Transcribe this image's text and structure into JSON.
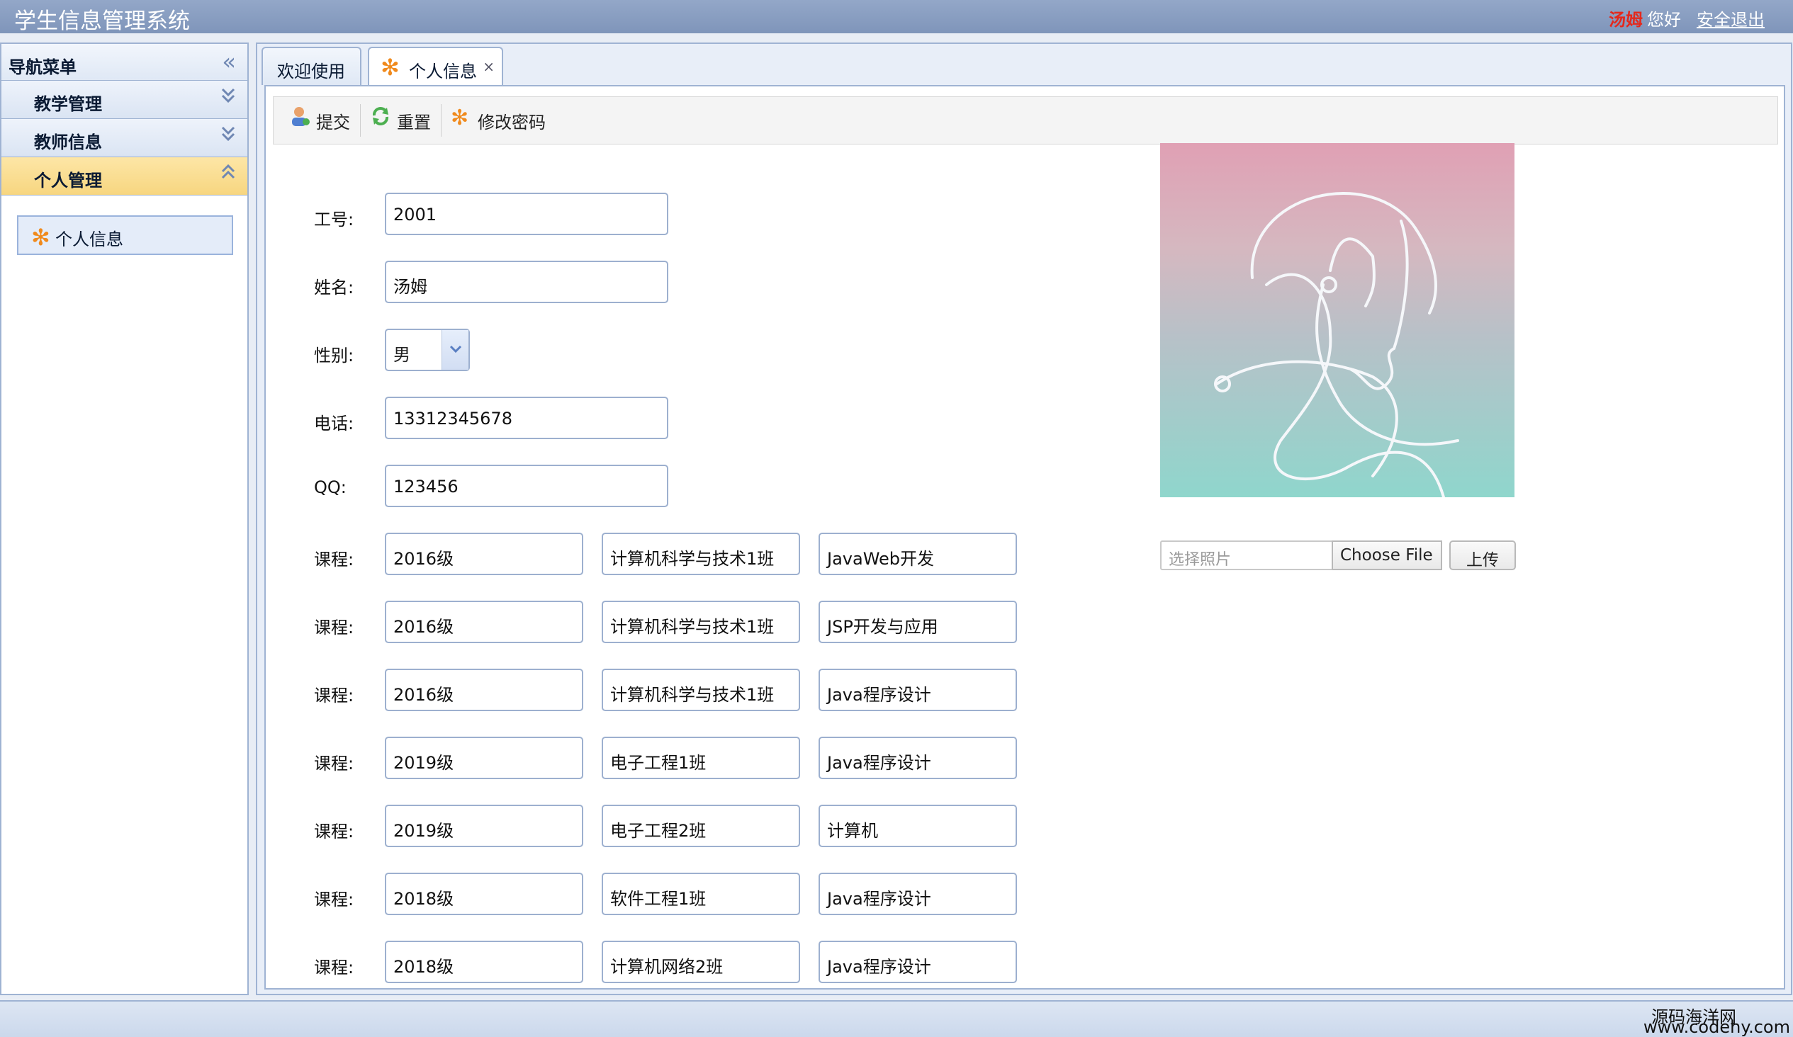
{
  "header": {
    "title": "学生信息管理系统",
    "user_name": "汤姆",
    "greeting": "您好",
    "logout": "安全退出"
  },
  "sidebar": {
    "title": "导航菜单",
    "collapse_icon": "double-chevron-left-icon",
    "groups": [
      {
        "label": "教学管理",
        "icon": "double-chevron-down-icon"
      },
      {
        "label": "教师信息",
        "icon": "double-chevron-down-icon"
      },
      {
        "label": "个人管理",
        "icon": "double-chevron-up-icon",
        "active": true
      }
    ],
    "items": [
      {
        "label": "个人信息",
        "icon": "gear-star-icon"
      }
    ]
  },
  "tabs": [
    {
      "label": "欢迎使用"
    },
    {
      "label": "个人信息",
      "closable": true,
      "close_symbol": "×"
    }
  ],
  "toolbar": {
    "submit": "提交",
    "reset": "重置",
    "change_password": "修改密码"
  },
  "form": {
    "id_label": "工号:",
    "id_value": "2001",
    "name_label": "姓名:",
    "name_value": "汤姆",
    "gender_label": "性别:",
    "gender_value": "男",
    "phone_label": "电话:",
    "phone_value": "13312345678",
    "qq_label": "QQ:",
    "qq_value": "123456",
    "course_label": "课程:",
    "courses": [
      {
        "grade": "2016级",
        "class": "计算机科学与技术1班",
        "course": "JavaWeb开发"
      },
      {
        "grade": "2016级",
        "class": "计算机科学与技术1班",
        "course": "JSP开发与应用"
      },
      {
        "grade": "2016级",
        "class": "计算机科学与技术1班",
        "course": "Java程序设计"
      },
      {
        "grade": "2019级",
        "class": "电子工程1班",
        "course": "Java程序设计"
      },
      {
        "grade": "2019级",
        "class": "电子工程2班",
        "course": "计算机"
      },
      {
        "grade": "2018级",
        "class": "软件工程1班",
        "course": "Java程序设计"
      },
      {
        "grade": "2018级",
        "class": "计算机网络2班",
        "course": "Java程序设计"
      }
    ]
  },
  "photo": {
    "file_placeholder": "选择照片",
    "choose_file": "Choose File",
    "upload": "上传"
  },
  "watermark": {
    "line1": "源码海洋网",
    "line2": "www.codehy.com"
  },
  "colors": {
    "header_bg": "#8399bd",
    "active_group_bg": "#f9dc8a",
    "border": "#9fb3d3",
    "username": "#e4281c"
  }
}
